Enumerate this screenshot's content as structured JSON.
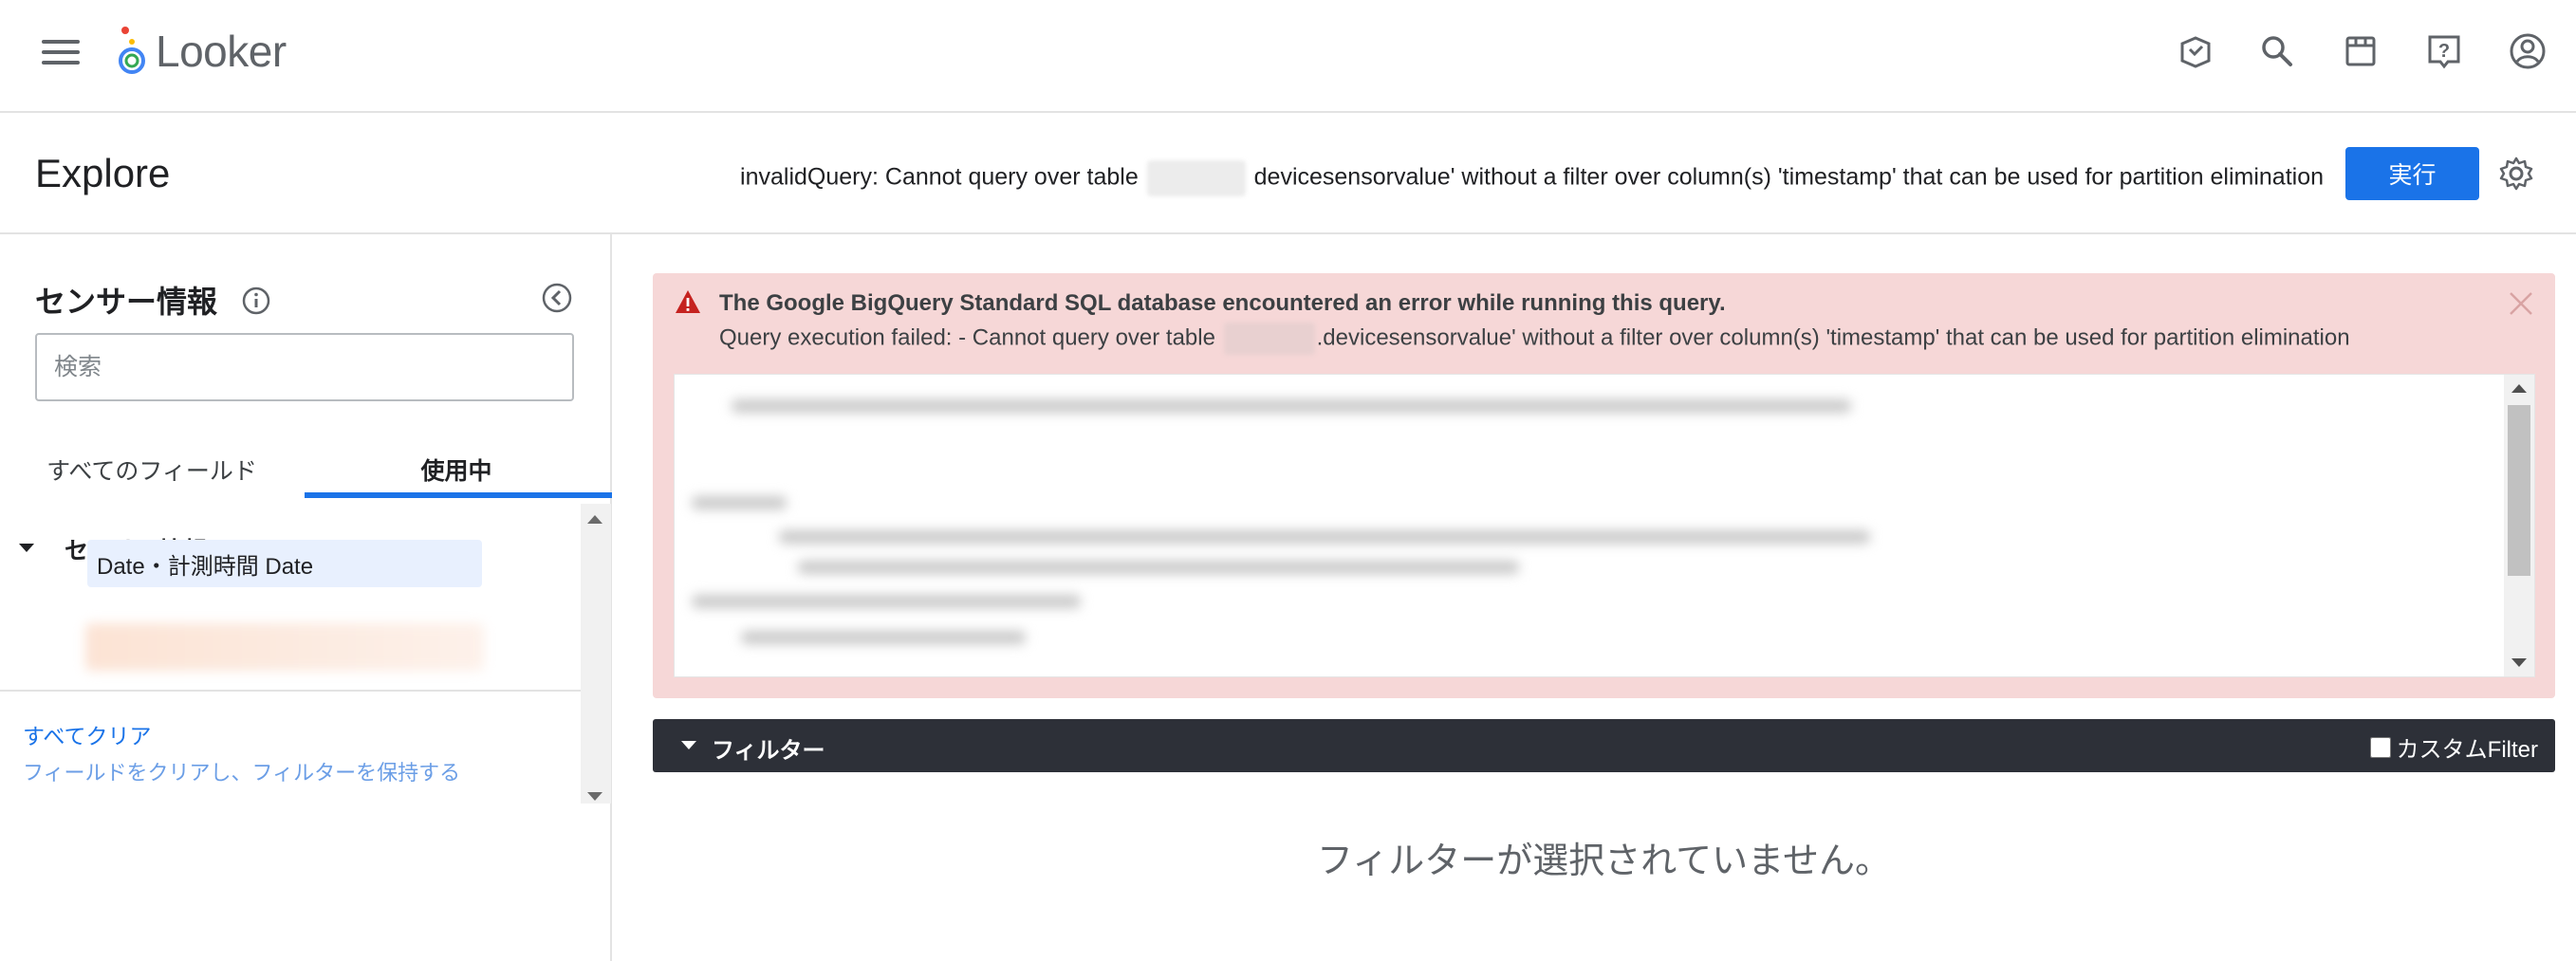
{
  "app": {
    "brand": "Looker",
    "brand_colors": {
      "accent": "#1a73e8",
      "logo_blue": "#4285f4",
      "logo_red": "#ea4335",
      "logo_yellow": "#fbbc04",
      "logo_green": "#34a853"
    }
  },
  "topbar": {
    "icons": [
      "menu-icon",
      "learning-icon",
      "search-icon",
      "marketplace-icon",
      "help-icon",
      "account-icon"
    ]
  },
  "explore": {
    "title": "Explore",
    "error_inline_prefix": "invalidQuery: Cannot query over table",
    "error_inline_suffix": "devicesensorvalue' without a filter over column(s) 'timestamp' that can be used for partition elimination",
    "run_label": "実行"
  },
  "field_picker": {
    "title": "センサー情報",
    "search_placeholder": "検索",
    "tabs": [
      {
        "label": "すべてのフィールド",
        "active": false
      },
      {
        "label": "使用中",
        "active": true
      }
    ],
    "group_label": "センサー情報",
    "selected_field": "Date・計測時間 Date",
    "clear_all": "すべてクリア",
    "clear_fields_keep_filters": "フィールドをクリアし、フィルターを保持する"
  },
  "error_panel": {
    "title": "The Google BigQuery Standard SQL database encountered an error while running this query.",
    "message_prefix": "Query execution failed: - Cannot query over table",
    "message_suffix": ".devicesensorvalue' without a filter over column(s) 'timestamp' that can be used for partition elimination",
    "background": "#f6d7d7",
    "icon_color": "#c5221f"
  },
  "filters": {
    "label": "フィルター",
    "custom_filter_label": "カスタムFilter",
    "custom_filter_checked": false,
    "empty_message": "フィルターが選択されていません。"
  }
}
